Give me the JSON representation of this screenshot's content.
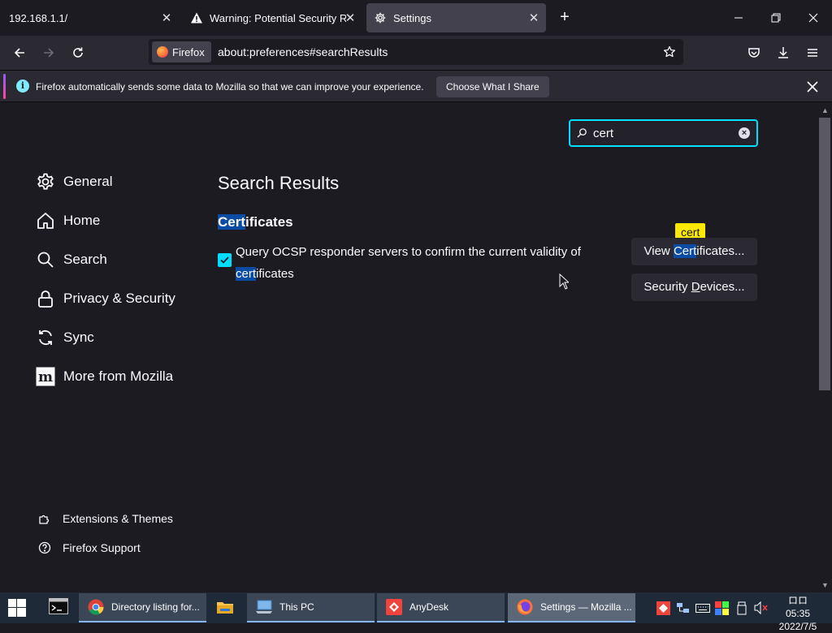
{
  "tabs": [
    {
      "title": "192.168.1.1/",
      "icon": "none"
    },
    {
      "title": "Warning: Potential Security Risk Ahead",
      "icon": "warning-icon"
    },
    {
      "title": "Settings",
      "icon": "gear-icon"
    }
  ],
  "toolbar": {
    "identity_label": "Firefox",
    "url": "about:preferences#searchResults"
  },
  "notification": {
    "message": "Firefox automatically sends some data to Mozilla so that we can improve your experience.",
    "button_label": "Choose What I Share"
  },
  "search": {
    "value": "cert"
  },
  "sidebar": {
    "categories": [
      {
        "label": "General",
        "icon": "gear-icon"
      },
      {
        "label": "Home",
        "icon": "home-icon"
      },
      {
        "label": "Search",
        "icon": "search-icon"
      },
      {
        "label": "Privacy & Security",
        "icon": "lock-icon"
      },
      {
        "label": "Sync",
        "icon": "sync-icon"
      },
      {
        "label": "More from Mozilla",
        "icon": "mozilla-icon"
      }
    ],
    "footer": [
      {
        "label": "Extensions & Themes",
        "icon": "puzzle-icon"
      },
      {
        "label": "Firefox Support",
        "icon": "help-icon"
      }
    ]
  },
  "main": {
    "results_title": "Search Results",
    "section": {
      "heading_highlight": "Cert",
      "heading_rest": "ificates",
      "checkbox_checked": true,
      "label_line1": "Query OCSP responder servers to confirm the current validity of",
      "label_highlight": "cert",
      "label_rest": "ificates",
      "tooltip": "cert",
      "view_button_pre": "View ",
      "view_button_highlight": "Cert",
      "view_button_post": "ificates...",
      "devices_button_pre": "Security ",
      "devices_button_underline": "D",
      "devices_button_post": "evices..."
    }
  },
  "taskbar": {
    "apps": [
      {
        "label": "Directory listing for...",
        "icon": "chrome-icon"
      },
      {
        "label": "This PC",
        "icon": "pc-icon"
      },
      {
        "label": "AnyDesk",
        "icon": "anydesk-icon"
      },
      {
        "label": "Settings — Mozilla ...",
        "icon": "firefox-icon"
      }
    ],
    "clock_time": "ロロ 05:35",
    "clock_date": "2022/7/5"
  },
  "colors": {
    "accent": "#00ddff",
    "highlight": "#0a4ba3",
    "tooltip": "#ffe900"
  }
}
